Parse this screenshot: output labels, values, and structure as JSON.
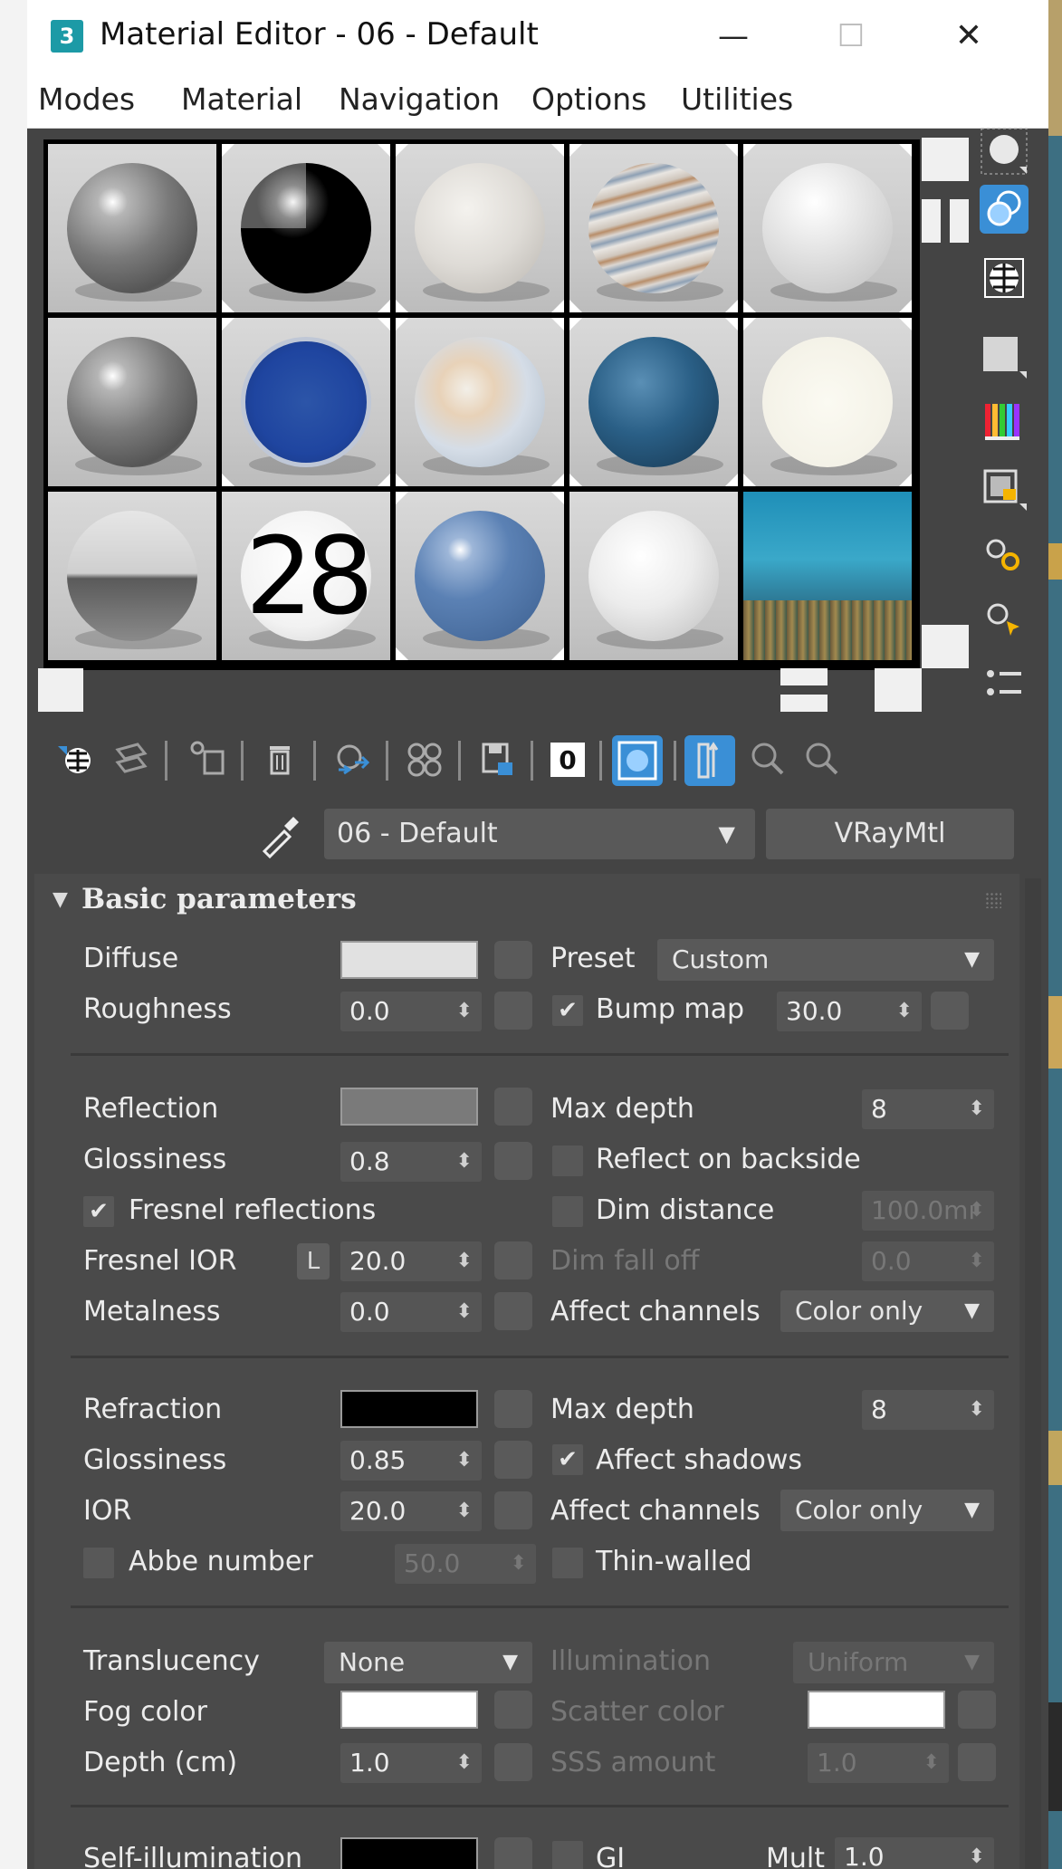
{
  "window": {
    "title": "Material Editor - 06 - Default",
    "app_icon_glyph": "3",
    "minimize_icon": "—",
    "maximize_icon": "☐",
    "close_icon": "✕"
  },
  "menu": [
    "Modes",
    "Material",
    "Navigation",
    "Options",
    "Utilities"
  ],
  "slots": {
    "sphere_28_text": "28"
  },
  "material": {
    "name": "06 - Default",
    "type": "VRayMtl"
  },
  "rollout": {
    "title": "Basic parameters"
  },
  "params": {
    "diffuse": "Diffuse",
    "roughness": "Roughness",
    "roughness_val": "0.0",
    "preset": "Preset",
    "preset_val": "Custom",
    "bump_map": "Bump map",
    "bump_val": "30.0",
    "reflection": "Reflection",
    "refl_gloss": "Glossiness",
    "refl_gloss_val": "0.8",
    "fresnel_reflections": "Fresnel reflections",
    "fresnel_ior": "Fresnel IOR",
    "fresnel_lock": "L",
    "fresnel_ior_val": "20.0",
    "metalness": "Metalness",
    "metalness_val": "0.0",
    "refl_max_depth": "Max depth",
    "refl_max_depth_val": "8",
    "reflect_backside": "Reflect on backside",
    "dim_distance": "Dim distance",
    "dim_distance_val": "100.0mı",
    "dim_falloff": "Dim fall off",
    "dim_falloff_val": "0.0",
    "affect_channels": "Affect channels",
    "affect_channels_val": "Color only",
    "refraction": "Refraction",
    "refr_gloss": "Glossiness",
    "refr_gloss_val": "0.85",
    "ior": "IOR",
    "ior_val": "20.0",
    "abbe": "Abbe number",
    "abbe_val": "50.0",
    "refr_max_depth": "Max depth",
    "refr_max_depth_val": "8",
    "affect_shadows": "Affect shadows",
    "refr_affect_channels": "Affect channels",
    "refr_affect_channels_val": "Color only",
    "thin_walled": "Thin-walled",
    "translucency": "Translucency",
    "translucency_val": "None",
    "fog_color": "Fog color",
    "depth": "Depth (cm)",
    "depth_val": "1.0",
    "illumination": "Illumination",
    "illumination_val": "Uniform",
    "scatter_color": "Scatter color",
    "sss_amount": "SSS amount",
    "sss_amount_val": "1.0",
    "self_illum": "Self-illumination",
    "gi": "GI",
    "mult": "Mult",
    "mult_val": "1.0"
  },
  "colors": {
    "panel": "#444444",
    "accent_blue": "#3a8fd6",
    "check": "✔",
    "spinner_arrows": "⬍",
    "dropdown_arrow": "▼"
  }
}
